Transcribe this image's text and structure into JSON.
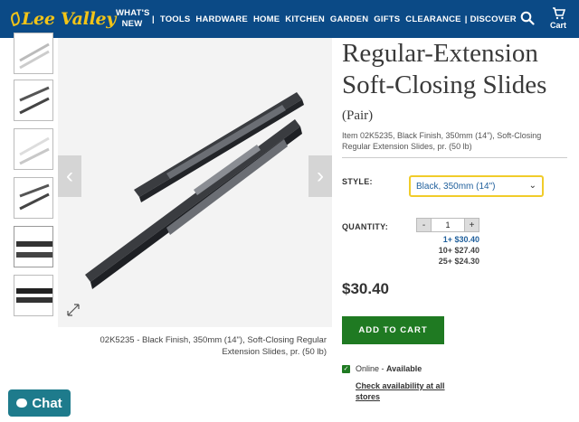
{
  "brand": {
    "logo_text": "Lee Valley",
    "color": "#f3c417"
  },
  "nav": {
    "whats_new": "WHAT'S NEW",
    "items": [
      "TOOLS",
      "HARDWARE",
      "HOME",
      "KITCHEN",
      "GARDEN",
      "GIFTS",
      "CLEARANCE",
      "DISCOVER"
    ]
  },
  "cart": {
    "label": "Cart"
  },
  "gallery": {
    "caption": "02K5235 - Black Finish, 350mm (14\"), Soft-Closing Regular Extension Slides, pr. (50 lb)"
  },
  "product": {
    "title": "Regular-Extension Soft-Closing Slides",
    "subtitle": "(Pair)",
    "item_desc": "Item 02K5235, Black Finish, 350mm (14\"), Soft-Closing Regular Extension Slides, pr. (50 lb)",
    "style_label": "STYLE:",
    "style_value": "Black, 350mm (14\")",
    "quantity_label": "QUANTITY:",
    "quantity": "1",
    "tiers": [
      "1+ $30.40",
      "10+ $27.40",
      "25+ $24.30"
    ],
    "price": "$30.40",
    "add_to_cart": "ADD TO CART",
    "online": "Online",
    "available": "Available",
    "check_availability": "Check availability at all stores"
  },
  "chat": {
    "label": "Chat"
  },
  "colors": {
    "header": "#0b4a86",
    "accent_green": "#1f7a22",
    "select_border": "#f1cc2a",
    "chat": "#1e7b8c"
  }
}
